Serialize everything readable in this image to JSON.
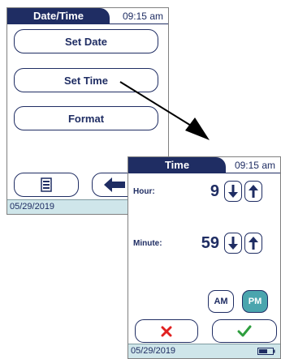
{
  "date_time_screen": {
    "title": "Date/Time",
    "clock": "09:15 am",
    "buttons": {
      "set_date": "Set Date",
      "set_time": "Set Time",
      "format": "Format"
    },
    "status_date": "05/29/2019"
  },
  "time_screen": {
    "title": "Time",
    "clock": "09:15 am",
    "hour_label": "Hour:",
    "hour_value": "9",
    "minute_label": "Minute:",
    "minute_value": "59",
    "am_label": "AM",
    "pm_label": "PM",
    "selected_period": "PM",
    "status_date": "05/29/2019"
  },
  "icons": {
    "menu": "list-menu-icon",
    "back": "back-arrow-icon",
    "up": "arrow-up-icon",
    "down": "arrow-down-icon",
    "cancel": "x-icon",
    "confirm": "checkmark-icon",
    "battery": "battery-icon"
  },
  "colors": {
    "navy": "#1f2d63",
    "status_bar": "#cfe6ea",
    "selected_pm": "#4aa5ae",
    "cancel_red": "#e02020",
    "confirm_green": "#2e9e3e"
  }
}
